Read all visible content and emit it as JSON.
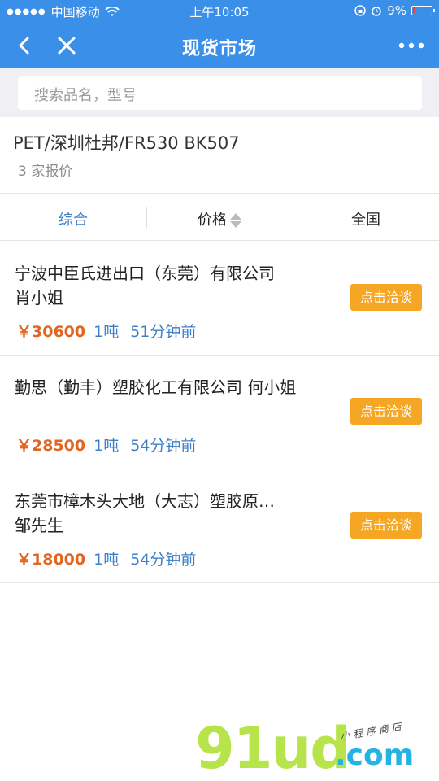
{
  "status_bar": {
    "carrier": "中国移动",
    "time": "上午10:05",
    "battery": "9%",
    "battery_level": 0.09
  },
  "nav": {
    "title": "现货市场"
  },
  "search": {
    "placeholder": "搜索品名，型号"
  },
  "product": {
    "name": "PET/深圳杜邦/FR530 BK507",
    "quote_count": "3 家报价"
  },
  "sort_tabs": [
    {
      "label": "综合"
    },
    {
      "label": "价格"
    },
    {
      "label": "全国"
    }
  ],
  "offers": [
    {
      "company": "宁波中臣氏进出口（东莞）有限公司",
      "contact": "肖小姐",
      "price": "￥30600",
      "quantity": "1吨",
      "time_ago": "51分钟前",
      "button": "点击洽谈"
    },
    {
      "company": "勤思（勤丰）塑胶化工有限公司  何小姐",
      "contact": "",
      "price": "￥28500",
      "quantity": "1吨",
      "time_ago": "54分钟前",
      "button": "点击洽谈"
    },
    {
      "company": "东莞市樟木头大地（大志）塑胶原…",
      "contact": "邹先生",
      "price": "￥18000",
      "quantity": "1吨",
      "time_ago": "54分钟前",
      "button": "点击洽谈"
    }
  ],
  "watermark": {
    "logo": "91ud",
    "domain": ".com",
    "tagline": "小程序商店"
  },
  "colors": {
    "nav_bg": "#3a8fe8",
    "accent_blue": "#3d80c9",
    "price_orange": "#e2661f",
    "button_orange": "#f5a623"
  }
}
